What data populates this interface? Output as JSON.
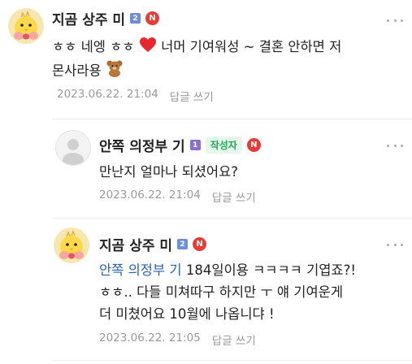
{
  "comments": [
    {
      "author": "지곰 상주 미",
      "level_badge": "2",
      "new_badge": "N",
      "text_parts": [
        "ㅎㅎ 네엥 ㅎㅎ ",
        " 너머 기여워성 ~ 결혼 안하면 저",
        "몬사라용 "
      ],
      "date": "2023.06.22. 21:04",
      "reply_label": "답글 쓰기"
    },
    {
      "author": "안쪽 의정부 기",
      "level_badge": "1",
      "author_badge": "작성자",
      "new_badge": "N",
      "text": "만난지 얼마나 되셨어요?",
      "date": "2023.06.22. 21:04",
      "reply_label": "답글 쓰기"
    },
    {
      "author": "지곰 상주 미",
      "level_badge": "2",
      "new_badge": "N",
      "mention": "안쪽 의정부 기",
      "text_line1": " 184일이용 ㅋㅋㅋㅋ 기엽죠?!",
      "text_line2": "ㅎㅎ.. 다들 미쳐따구 하지만 ㅜ 얘 기여운게",
      "text_line3": "더 미쳤어요 10월에 나옵니댜 !",
      "date": "2023.06.22. 21:05",
      "reply_label": "답글 쓰기"
    }
  ],
  "colors": {
    "level2": "#6f8fd8",
    "level1": "#8a6fcf",
    "new_badge": "#ea3b35",
    "mention": "#2a63b5",
    "author_badge_bg": "#e6f7ec",
    "author_badge_text": "#1fa956"
  },
  "icons": [
    "chick-avatar-icon",
    "default-avatar-icon",
    "heart-icon",
    "teddy-bear-icon",
    "more-icon"
  ]
}
